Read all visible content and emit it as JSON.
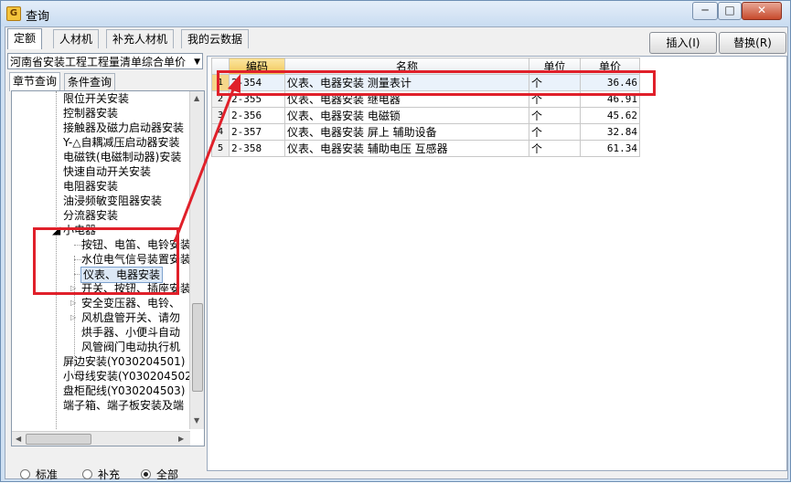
{
  "window": {
    "title": "查询",
    "minimize": "─",
    "maximize": "□",
    "close": "✕"
  },
  "tabs": [
    "定额",
    "人材机",
    "补充人材机",
    "我的云数据"
  ],
  "buttons": {
    "insert": "插入(I)",
    "replace": "替换(R)"
  },
  "quota_combo": "河南省安装工程工程量清单综合单价",
  "subtabs": [
    "章节查询",
    "条件查询"
  ],
  "tree": {
    "items": [
      "限位开关安装",
      "控制器安装",
      "接触器及磁力启动器安装",
      "Y-△自耦减压启动器安装",
      "电磁铁(电磁制动器)安装",
      "快速自动开关安装",
      "电阻器安装",
      "油浸频敏变阻器安装",
      "分流器安装",
      "小电器",
      "按钮、电笛、电铃安装",
      "水位电气信号装置安装",
      "仪表、电器安装",
      "开关、按钮、插座安装",
      "安全变压器、电铃、",
      "风机盘管开关、请勿",
      "烘手器、小便斗自动",
      "风管阀门电动执行机",
      "屏边安装(Y030204501)",
      "小母线安装(Y030204502)",
      "盘柜配线(Y030204503)",
      "端子箱、端子板安装及端"
    ]
  },
  "radios": [
    "标准",
    "补充",
    "全部"
  ],
  "radio_selected": "全部",
  "table": {
    "headers": [
      "编码",
      "名称",
      "单位",
      "单价"
    ],
    "rows": [
      {
        "idx": "1",
        "code": "2-354",
        "name": "仪表、电器安装 测量表计",
        "unit": "个",
        "price": "36.46"
      },
      {
        "idx": "2",
        "code": "2-355",
        "name": "仪表、电器安装 继电器",
        "unit": "个",
        "price": "46.91"
      },
      {
        "idx": "3",
        "code": "2-356",
        "name": "仪表、电器安装 电磁锁",
        "unit": "个",
        "price": "45.62"
      },
      {
        "idx": "4",
        "code": "2-357",
        "name": "仪表、电器安装 屏上 辅助设备",
        "unit": "个",
        "price": "32.84"
      },
      {
        "idx": "5",
        "code": "2-358",
        "name": "仪表、电器安装 辅助电压 互感器",
        "unit": "个",
        "price": "61.34"
      }
    ]
  },
  "colors": {
    "annotation": "#e0202a",
    "selection": "#f5d78a"
  }
}
